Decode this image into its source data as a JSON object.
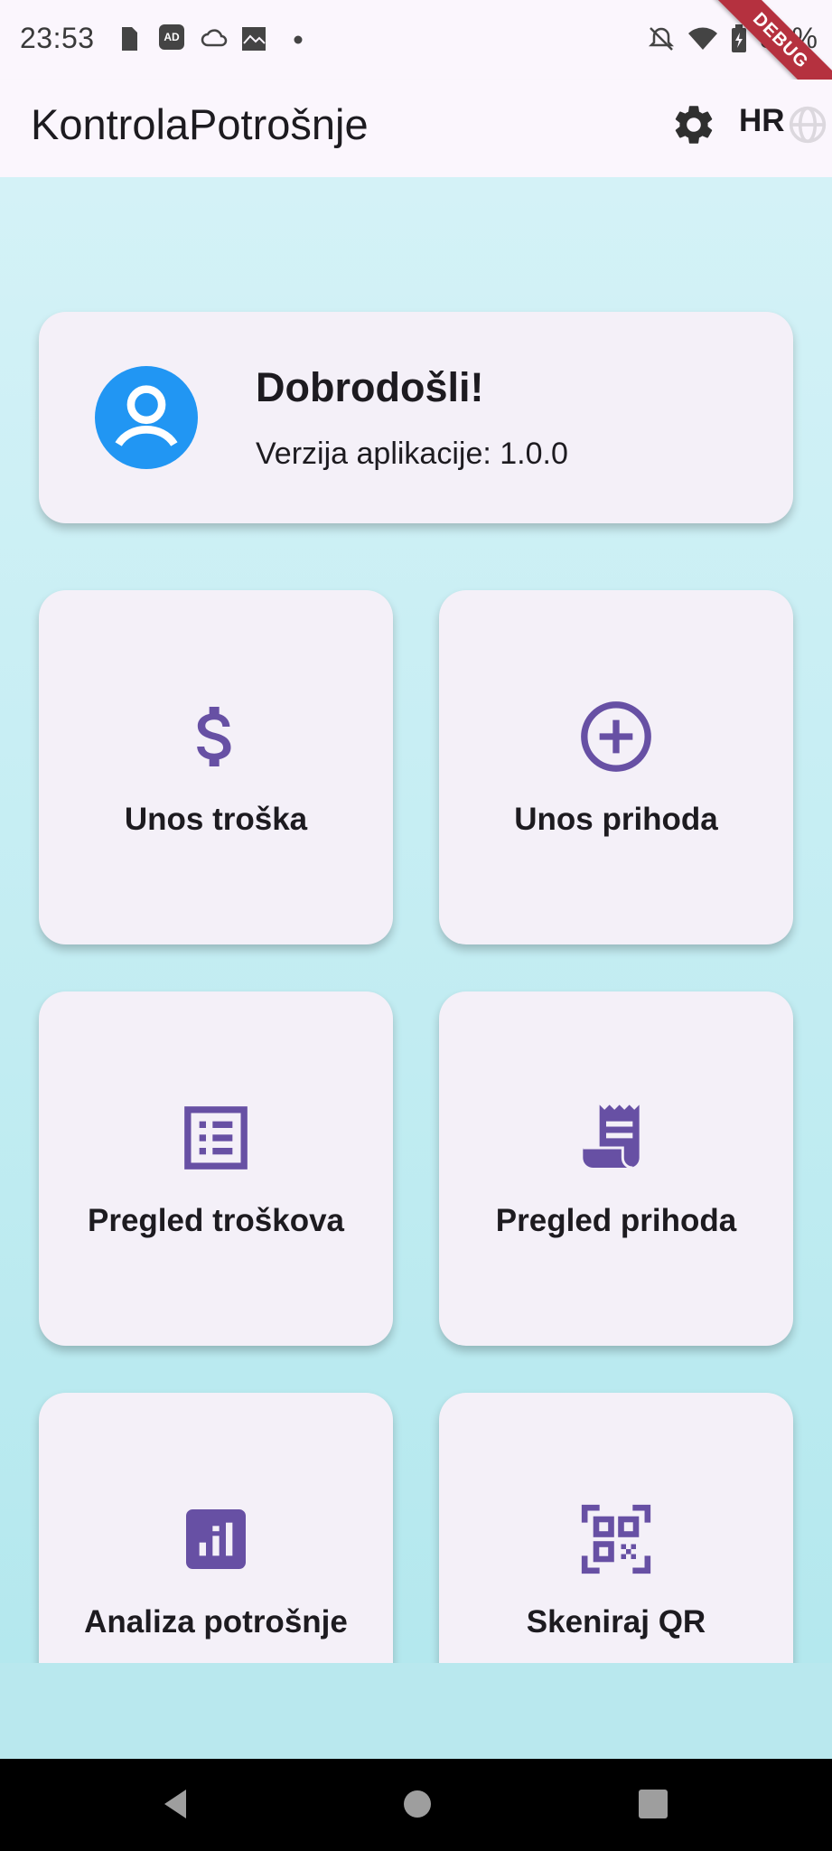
{
  "status_bar": {
    "time": "23:53",
    "battery": "80%",
    "debug_banner": "DEBUG"
  },
  "app_bar": {
    "title": "KontrolaPotrošnje",
    "language": "HR",
    "settings_icon": "gear-icon",
    "language_icon": "globe-icon"
  },
  "welcome": {
    "title": "Dobrodošli!",
    "version_text": "Verzija aplikacije: 1.0.0",
    "icon": "account-circle-icon"
  },
  "tiles": [
    {
      "label": "Unos troška",
      "icon": "dollar-icon"
    },
    {
      "label": "Unos prihoda",
      "icon": "add-circle-icon"
    },
    {
      "label": "Pregled troškova",
      "icon": "list-alt-icon"
    },
    {
      "label": "Pregled prihoda",
      "icon": "receipt-icon"
    },
    {
      "label": "Analiza potrošnje",
      "icon": "analytics-icon"
    },
    {
      "label": "Skeniraj QR",
      "icon": "qr-code-scanner-icon"
    }
  ],
  "colors": {
    "accent": "#6750a4",
    "avatar": "#2196f3",
    "card": "#f4f0f8",
    "background_top": "#d4f2f7",
    "background_bottom": "#b4e8ee"
  }
}
